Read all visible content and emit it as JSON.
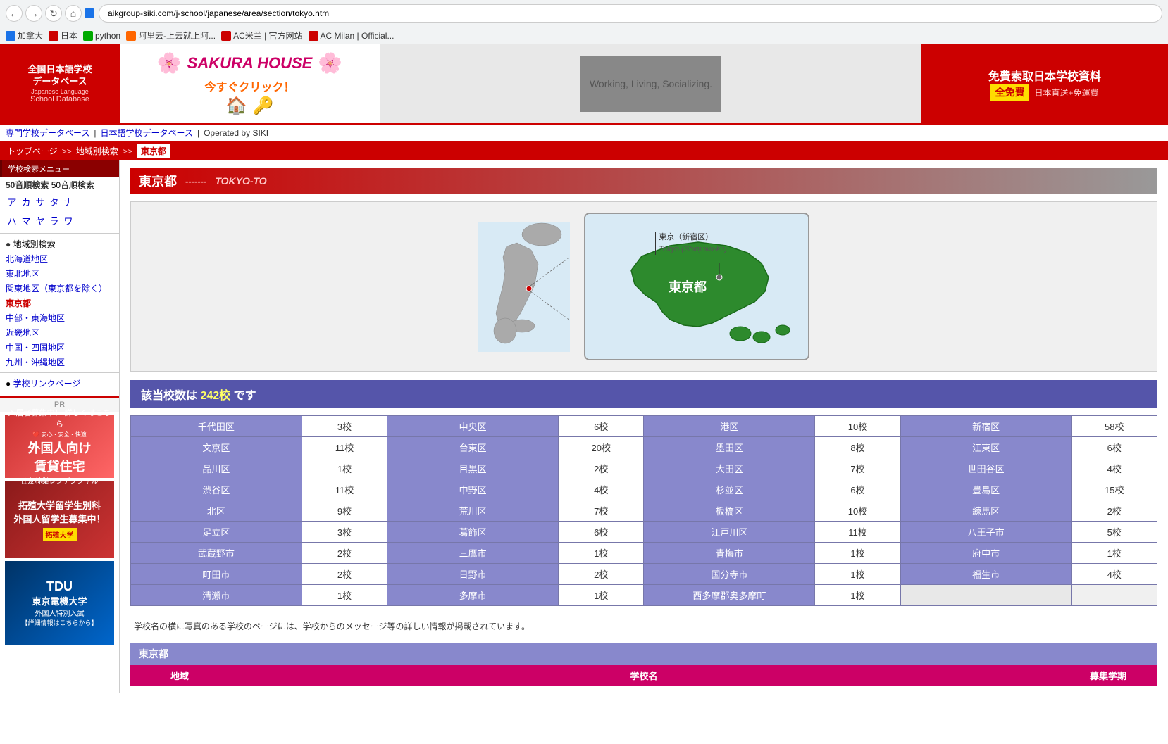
{
  "browser": {
    "url": "aikgroup-siki.com/j-school/japanese/area/section/tokyo.htm",
    "bookmarks": [
      {
        "label": "加拿大",
        "color": "blue"
      },
      {
        "label": "日本",
        "color": "red"
      },
      {
        "label": "python",
        "color": "green"
      },
      {
        "label": "阿里云-上云就上阿...",
        "color": "orange"
      },
      {
        "label": "AC米兰 | 官方网站",
        "color": "red"
      },
      {
        "label": "AC Milan | Official...",
        "color": "red"
      }
    ]
  },
  "logo": {
    "line1": "全国日本語学校",
    "line2": "データベース",
    "line3": "Japanese Language",
    "line4": "School Database"
  },
  "sakura": {
    "brand": "SAKURA HOUSE",
    "cta": "今すぐクリック！"
  },
  "banner_middle": {
    "text": "Working, Living, Socializing."
  },
  "banner_right": {
    "main": "免費索取日本学校資料",
    "sub": "全免費",
    "desc": "日本直送+免運費"
  },
  "topnav": {
    "link1": "専門学校データベース",
    "separator1": "|",
    "link2": "日本語学校データベース",
    "separator2": "|",
    "operated": "Operated by SIKI"
  },
  "breadcrumb": {
    "home": "トップページ",
    "sep1": ">>",
    "region": "地域別検索",
    "sep2": ">>",
    "current": "東京都"
  },
  "sidebar": {
    "search_menu": "学校検索メニュー",
    "50on_header": "50音順検索",
    "hiragana_row1": [
      "ア",
      "カ",
      "サ",
      "タ",
      "ナ"
    ],
    "hiragana_row2": [
      "ハ",
      "マ",
      "ヤ",
      "ラ",
      "ワ"
    ],
    "region_header": "地域別検索",
    "regions": [
      "北海道地区",
      "東北地区",
      "関東地区（東京都を除く）",
      "東京都",
      "中部・東海地区",
      "近畿地区",
      "中国・四国地区",
      "九州・沖縄地区"
    ],
    "link_header": "学校リンクページ",
    "pr_label": "PR"
  },
  "map": {
    "title_jp": "東京都",
    "title_sep": "-------",
    "title_en": "TOKYO-TO",
    "shinjuku_jp": "東京（新宿区）",
    "shinjuku_en": "Tokyo (Shinjuku-ku)",
    "tokyo_label": "東京都"
  },
  "school_count": {
    "prefix": "該当校数は",
    "number": "242校",
    "suffix": "です"
  },
  "districts": [
    {
      "name": "千代田区",
      "count": "3校",
      "name2": "中央区",
      "count2": "6校",
      "name3": "港区",
      "count3": "10校",
      "name4": "新宿区",
      "count4": "58校"
    },
    {
      "name": "文京区",
      "count": "11校",
      "name2": "台東区",
      "count2": "20校",
      "name3": "墨田区",
      "count3": "8校",
      "name4": "江東区",
      "count4": "6校"
    },
    {
      "name": "品川区",
      "count": "1校",
      "name2": "目黒区",
      "count2": "2校",
      "name3": "大田区",
      "count3": "7校",
      "name4": "世田谷区",
      "count4": "4校"
    },
    {
      "name": "渋谷区",
      "count": "11校",
      "name2": "中野区",
      "count2": "4校",
      "name3": "杉並区",
      "count3": "6校",
      "name4": "豊島区",
      "count4": "15校"
    },
    {
      "name": "北区",
      "count": "9校",
      "name2": "荒川区",
      "count2": "7校",
      "name3": "板橋区",
      "count3": "10校",
      "name4": "練馬区",
      "count4": "2校"
    },
    {
      "name": "足立区",
      "count": "3校",
      "name2": "葛飾区",
      "count2": "6校",
      "name3": "江戸川区",
      "count3": "11校",
      "name4": "八王子市",
      "count4": "5校"
    },
    {
      "name": "武蔵野市",
      "count": "2校",
      "name2": "三鷹市",
      "count2": "1校",
      "name3": "青梅市",
      "count3": "1校",
      "name4": "府中市",
      "count4": "1校"
    },
    {
      "name": "町田市",
      "count": "2校",
      "name2": "日野市",
      "count2": "2校",
      "name3": "国分寺市",
      "count3": "1校",
      "name4": "福生市",
      "count4": "4校"
    },
    {
      "name": "清瀬市",
      "count": "1校",
      "name2": "多摩市",
      "count2": "1校",
      "name3": "西多摩郡奥多摩町",
      "count3": "1校",
      "name4": "",
      "count4": ""
    }
  ],
  "bottom_note": "学校名の横に写真のある学校のページには、学校からのメッセージ等の詳しい情報が掲載されています。",
  "listing": {
    "header": "東京都",
    "col_region": "地域",
    "col_school": "学校名",
    "col_count": "募集学期"
  },
  "pr_banners": [
    {
      "bg": "#cc3333",
      "main": "入居者募集中！",
      "sub": "詳しくはこちら",
      "title": "外国人向け 賃貸住宅",
      "company": "住友林業レジデンシャル"
    },
    {
      "bg": "#8B1A1A",
      "main": "拓殖大学留学生別科",
      "sub": "外国人留学生募集中！",
      "title": "",
      "company": "拓殖大学"
    },
    {
      "bg": "#003366",
      "main": "TDU",
      "sub": "東京電機大学",
      "title": "外国人特別入試",
      "company": "【詳細情報はこちらから】"
    }
  ]
}
